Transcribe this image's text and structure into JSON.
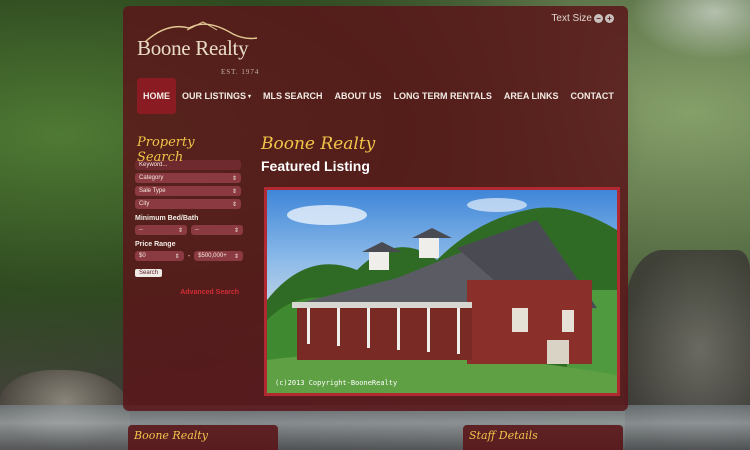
{
  "header": {
    "brand": "Boone Realty",
    "est": "EST. 1974",
    "text_size_label": "Text Size",
    "text_size_decrease": "−",
    "text_size_increase": "+"
  },
  "nav": {
    "items": [
      {
        "label": "HOME",
        "active": true
      },
      {
        "label": "OUR LISTINGS",
        "dropdown": true
      },
      {
        "label": "MLS SEARCH"
      },
      {
        "label": "ABOUT US"
      },
      {
        "label": "LONG TERM RENTALS"
      },
      {
        "label": "AREA LINKS"
      },
      {
        "label": "CONTACT"
      }
    ],
    "dropdown_caret": "▾"
  },
  "sidebar": {
    "title": "Property Search",
    "keyword_placeholder": "Keyword...",
    "category": "Category",
    "sale_type": "Sale Type",
    "city": "City",
    "bed_bath_label": "Minimum Bed/Bath",
    "bed_value": "--",
    "bath_value": "--",
    "price_label": "Price Range",
    "price_min": "$0",
    "price_separator": "-",
    "price_max": "$500,000+",
    "search_button": "Search",
    "advanced_search": "Advanced Search"
  },
  "main": {
    "brand": "Boone Realty",
    "heading": "Featured Listing",
    "photo_caption": "(c)2013 Copyright-BooneRealty"
  },
  "footer_cards": {
    "left": "Boone Realty",
    "right": "Staff Details"
  },
  "colors": {
    "accent_gold": "#f1c44a",
    "panel": "#5a161a",
    "nav_active": "#8a1b22",
    "photo_border": "#b12a32",
    "advanced_link": "#d22c36"
  }
}
